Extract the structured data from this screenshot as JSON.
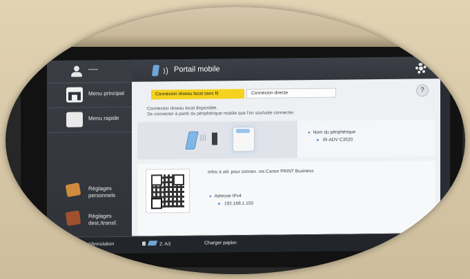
{
  "sidebar": {
    "items": [
      {
        "label": "Menu principal",
        "icon": "home-icon"
      },
      {
        "label": "Menu rapide",
        "icon": "users-icon"
      },
      {
        "label_line1": "Réglages",
        "label_line2": "personnels",
        "icon": "personal-settings-icon"
      },
      {
        "label_line1": "Réglages",
        "label_line2": "dest./transf.",
        "icon": "destination-settings-icon"
      }
    ],
    "user_placeholder": "—"
  },
  "header": {
    "title": "Portail mobile"
  },
  "tabs": [
    {
      "label": "Connexion réseau local sans fil",
      "active": true,
      "color": "#f4d21f"
    },
    {
      "label": "Connexion directe",
      "active": false
    }
  ],
  "help_label": "?",
  "info": {
    "line1": "Connexion réseau local disponible.",
    "line2": "Se connecter à partir du périphérique mobile que l'on souhaite connecter."
  },
  "device": {
    "label": "Nom du périphérique",
    "value": "iR-ADV C3520"
  },
  "app_info": "Infos à util. pour connex. via Canon PRINT Business",
  "network": {
    "label": "Adresse IPv4",
    "value": "192.168.1.150"
  },
  "statusbar": {
    "status_button": "Moni statut/Annulation",
    "tray": "2: A3",
    "message": "Charger papier."
  }
}
